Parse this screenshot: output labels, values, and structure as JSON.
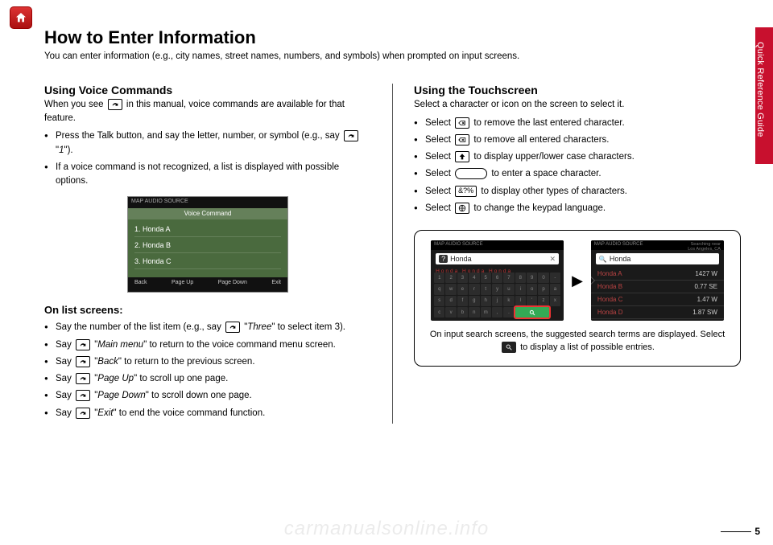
{
  "pageNumber": "5",
  "sideTab": "Quick Reference Guide",
  "watermark": "carmanualsonline.info",
  "header": {
    "title": "How to Enter Information",
    "intro": "You can enter information (e.g., city names, street names, numbers, and symbols) when prompted on input screens."
  },
  "left": {
    "h2": "Using Voice Commands",
    "lead_pre": "When you see ",
    "lead_post": " in this manual, voice commands are available for that feature.",
    "bullets1": [
      {
        "pre": "Press the Talk button, and say the letter, number, or symbol (e.g., say ",
        "cmd": "1",
        "post": ")."
      },
      {
        "text": "If a voice command is not recognized, a list is displayed with possible options."
      }
    ],
    "shot1": {
      "tabs": "MAP   AUDIO   SOURCE",
      "header": "Voice Command",
      "rows": [
        "1. Honda A",
        "2. Honda B",
        "3. Honda C"
      ],
      "footer": [
        "Back",
        "Page Up",
        "Page Down",
        "Exit"
      ]
    },
    "h3": "On list screens:",
    "bullets2": [
      {
        "pre": "Say the number of the list item (e.g., say ",
        "cmd": "Three",
        "post": " to select item 3)."
      },
      {
        "pre": "Say ",
        "cmd": "Main menu",
        "post": " to return to the voice command menu screen."
      },
      {
        "pre": "Say ",
        "cmd": "Back",
        "post": " to return to the previous screen."
      },
      {
        "pre": "Say ",
        "cmd": "Page Up",
        "post": " to scroll up one page."
      },
      {
        "pre": "Say ",
        "cmd": "Page Down",
        "post": " to scroll down one page."
      },
      {
        "pre": "Say ",
        "cmd": "Exit",
        "post": " to end the voice command function."
      }
    ]
  },
  "right": {
    "h2": "Using the Touchscreen",
    "lead": "Select a character or icon on the screen to select it.",
    "bullets": [
      {
        "pre": "Select ",
        "iconType": "backspace",
        "post": " to remove the last entered character."
      },
      {
        "pre": "Select ",
        "iconType": "clear",
        "post": " to remove all entered characters."
      },
      {
        "pre": "Select ",
        "iconType": "shift",
        "post": " to display upper/lower case characters."
      },
      {
        "pre": "Select ",
        "iconType": "space",
        "post": " to enter a space character."
      },
      {
        "pre": "Select ",
        "iconType": "symbols",
        "iconText": "&?%",
        "post": " to display other types of characters."
      },
      {
        "pre": "Select ",
        "iconType": "globe",
        "post": " to change the keypad language."
      }
    ],
    "shotA": {
      "tabs": "MAP   AUDIO   SOURCE",
      "query": "Honda",
      "suggest": "Honda   Honda   Honda"
    },
    "shotB": {
      "tabs": "MAP   AUDIO   SOURCE",
      "query": "Honda",
      "meta": "Searching near\nLos Angeles, CA",
      "rows": [
        {
          "name": "Honda A",
          "dist": "1427  W"
        },
        {
          "name": "Honda B",
          "dist": "0.77  SE"
        },
        {
          "name": "Honda C",
          "dist": "1.47  W"
        },
        {
          "name": "Honda D",
          "dist": "1.87  SW"
        }
      ]
    },
    "caption_pre": "On input search screens, the suggested search terms are displayed. Select ",
    "caption_post": " to display a list of possible entries."
  }
}
